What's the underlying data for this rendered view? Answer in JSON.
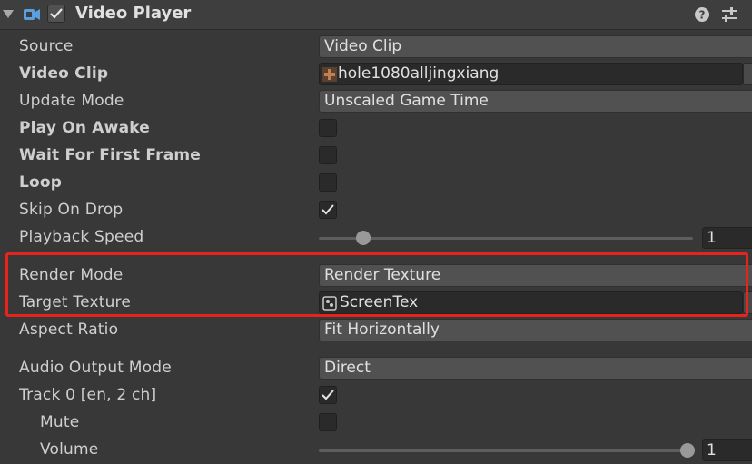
{
  "component": {
    "title": "Video Player",
    "enabled": true,
    "icons": [
      "video-camera-icon",
      "help-icon",
      "settings-sliders-icon"
    ]
  },
  "fields": {
    "source": {
      "label": "Source",
      "value": "Video Clip"
    },
    "video_clip": {
      "label": "Video Clip",
      "value": "hole1080alljingxiang"
    },
    "update_mode": {
      "label": "Update Mode",
      "value": "Unscaled Game Time"
    },
    "play_on_awake": {
      "label": "Play On Awake",
      "checked": false
    },
    "wait_first_frame": {
      "label": "Wait For First Frame",
      "checked": false
    },
    "loop": {
      "label": "Loop",
      "checked": false
    },
    "skip_on_drop": {
      "label": "Skip On Drop",
      "checked": true
    },
    "playback_speed": {
      "label": "Playback Speed",
      "value": "1",
      "fraction": 0.12
    },
    "render_mode": {
      "label": "Render Mode",
      "value": "Render Texture"
    },
    "target_texture": {
      "label": "Target Texture",
      "value": "ScreenTex"
    },
    "aspect_ratio": {
      "label": "Aspect Ratio",
      "value": "Fit Horizontally"
    },
    "audio_output_mode": {
      "label": "Audio Output Mode",
      "value": "Direct"
    },
    "track0": {
      "label": "Track 0 [en, 2 ch]",
      "checked": true
    },
    "mute": {
      "label": "Mute",
      "checked": false
    },
    "volume": {
      "label": "Volume",
      "value": "1",
      "fraction": 1.0
    }
  },
  "colors": {
    "background": "#383838",
    "field": "#515151",
    "highlight": "#e8231f"
  }
}
